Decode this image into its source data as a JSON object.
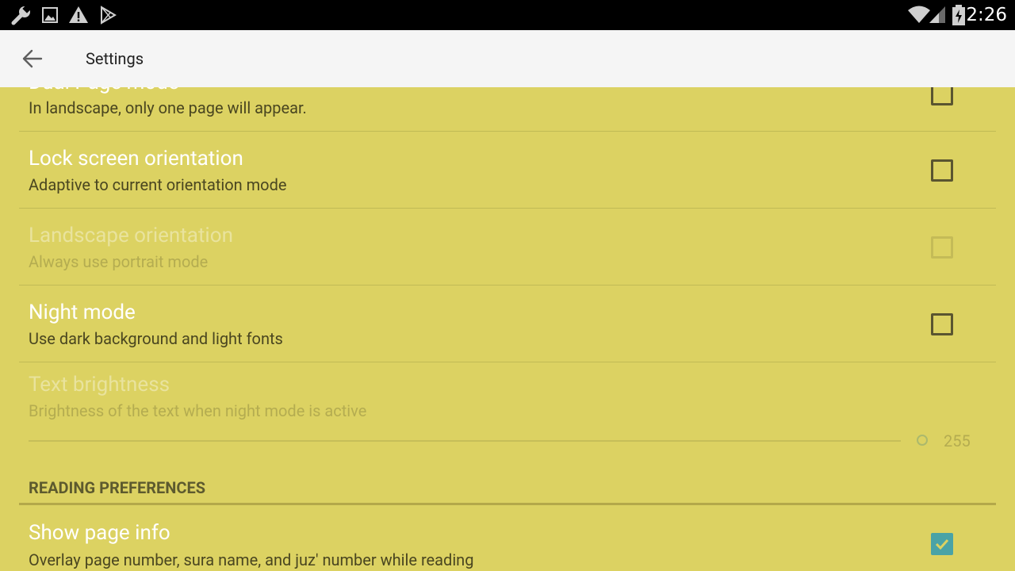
{
  "status_bar": {
    "time": "2:26",
    "left_icons": [
      "wrench-icon",
      "image-icon",
      "warning-icon",
      "play-store-icon"
    ],
    "right_icons": [
      "wifi-icon",
      "signal-icon",
      "battery-charging-icon"
    ]
  },
  "app_bar": {
    "title": "Settings",
    "back_icon": "arrow-back-icon"
  },
  "prefs": {
    "dual_page": {
      "title": "Dual Page mode",
      "summary": "In landscape, only one page will appear.",
      "checked": false
    },
    "lock_orientation": {
      "title": "Lock screen orientation",
      "summary": "Adaptive to current orientation mode",
      "checked": false
    },
    "landscape": {
      "title": "Landscape orientation",
      "summary": "Always use portrait mode",
      "checked": false,
      "enabled": false
    },
    "night_mode": {
      "title": "Night mode",
      "summary": "Use dark background and light fonts",
      "checked": false
    },
    "text_brightness": {
      "title": "Text brightness",
      "summary": "Brightness of the text when night mode is active",
      "value": "255",
      "enabled": false
    }
  },
  "sections": {
    "reading": "READING PREFERENCES"
  },
  "reading_prefs": {
    "show_page_info": {
      "title": "Show page info",
      "summary": "Overlay page number, sura name, and juz' number while reading",
      "checked": true
    }
  },
  "colors": {
    "background": "#dcd262",
    "accent": "#4aa3a6",
    "app_bar": "#f5f5f5"
  }
}
